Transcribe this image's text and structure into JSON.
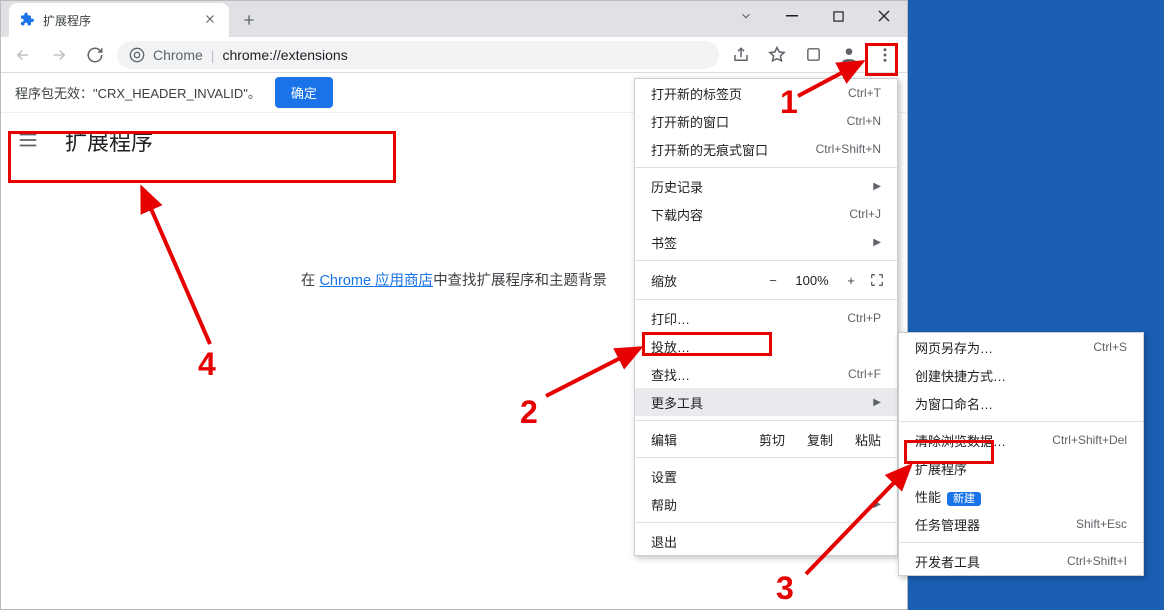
{
  "window": {
    "tab_title": "扩展程序",
    "address_label": "Chrome",
    "address_path": "chrome://extensions"
  },
  "infobar": {
    "message": "程序包无效：\"CRX_HEADER_INVALID\"。",
    "confirm": "确定"
  },
  "extensions": {
    "title": "扩展程序",
    "body_prefix": "在 ",
    "store_link": "Chrome 应用商店",
    "body_suffix": "中查找扩展程序和主题背景"
  },
  "menu": {
    "new_tab": "打开新的标签页",
    "new_tab_sc": "Ctrl+T",
    "new_window": "打开新的窗口",
    "new_window_sc": "Ctrl+N",
    "incognito": "打开新的无痕式窗口",
    "incognito_sc": "Ctrl+Shift+N",
    "history": "历史记录",
    "downloads": "下载内容",
    "downloads_sc": "Ctrl+J",
    "bookmarks": "书签",
    "zoom": "缩放",
    "zoom_val": "100%",
    "print": "打印…",
    "print_sc": "Ctrl+P",
    "cast": "投放…",
    "find": "查找…",
    "find_sc": "Ctrl+F",
    "more_tools": "更多工具",
    "edit": "编辑",
    "cut": "剪切",
    "copy": "复制",
    "paste": "粘贴",
    "settings": "设置",
    "help": "帮助",
    "exit": "退出"
  },
  "submenu": {
    "save_as": "网页另存为…",
    "save_as_sc": "Ctrl+S",
    "create_shortcut": "创建快捷方式…",
    "name_window": "为窗口命名…",
    "clear_data": "清除浏览数据…",
    "clear_data_sc": "Ctrl+Shift+Del",
    "extensions": "扩展程序",
    "performance": "性能",
    "perf_badge": "新建",
    "task_manager": "任务管理器",
    "task_manager_sc": "Shift+Esc",
    "dev_tools": "开发者工具",
    "dev_tools_sc": "Ctrl+Shift+I"
  },
  "annotations": {
    "n1": "1",
    "n2": "2",
    "n3": "3",
    "n4": "4"
  }
}
